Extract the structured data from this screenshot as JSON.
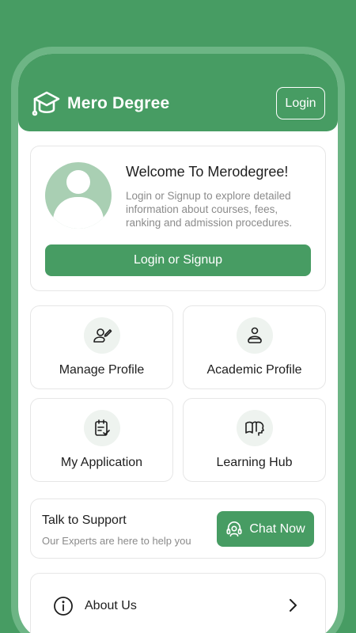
{
  "header": {
    "brand_name": "Mero Degree",
    "logo_icon": "graduation-cap-icon",
    "login_label": "Login"
  },
  "welcome": {
    "title": "Welcome To Merodegree!",
    "description": "Login or Signup to explore detailed information about courses, fees, ranking and admission procedures.",
    "button_label": "Login or Signup"
  },
  "tiles": [
    {
      "label": "Manage Profile",
      "icon": "user-edit-icon"
    },
    {
      "label": "Academic Profile",
      "icon": "user-desk-icon"
    },
    {
      "label": "My Application",
      "icon": "clipboard-check-icon"
    },
    {
      "label": "Learning Hub",
      "icon": "book-head-icon"
    }
  ],
  "support": {
    "title": "Talk to Support",
    "subtitle": "Our Experts are here to help you",
    "chat_label": "Chat Now"
  },
  "about": {
    "label": "About Us"
  },
  "colors": {
    "primary": "#479c63",
    "frame": "#6db585",
    "avatar_bg": "#a9cfb3",
    "icon_bg": "#eef3ef"
  }
}
